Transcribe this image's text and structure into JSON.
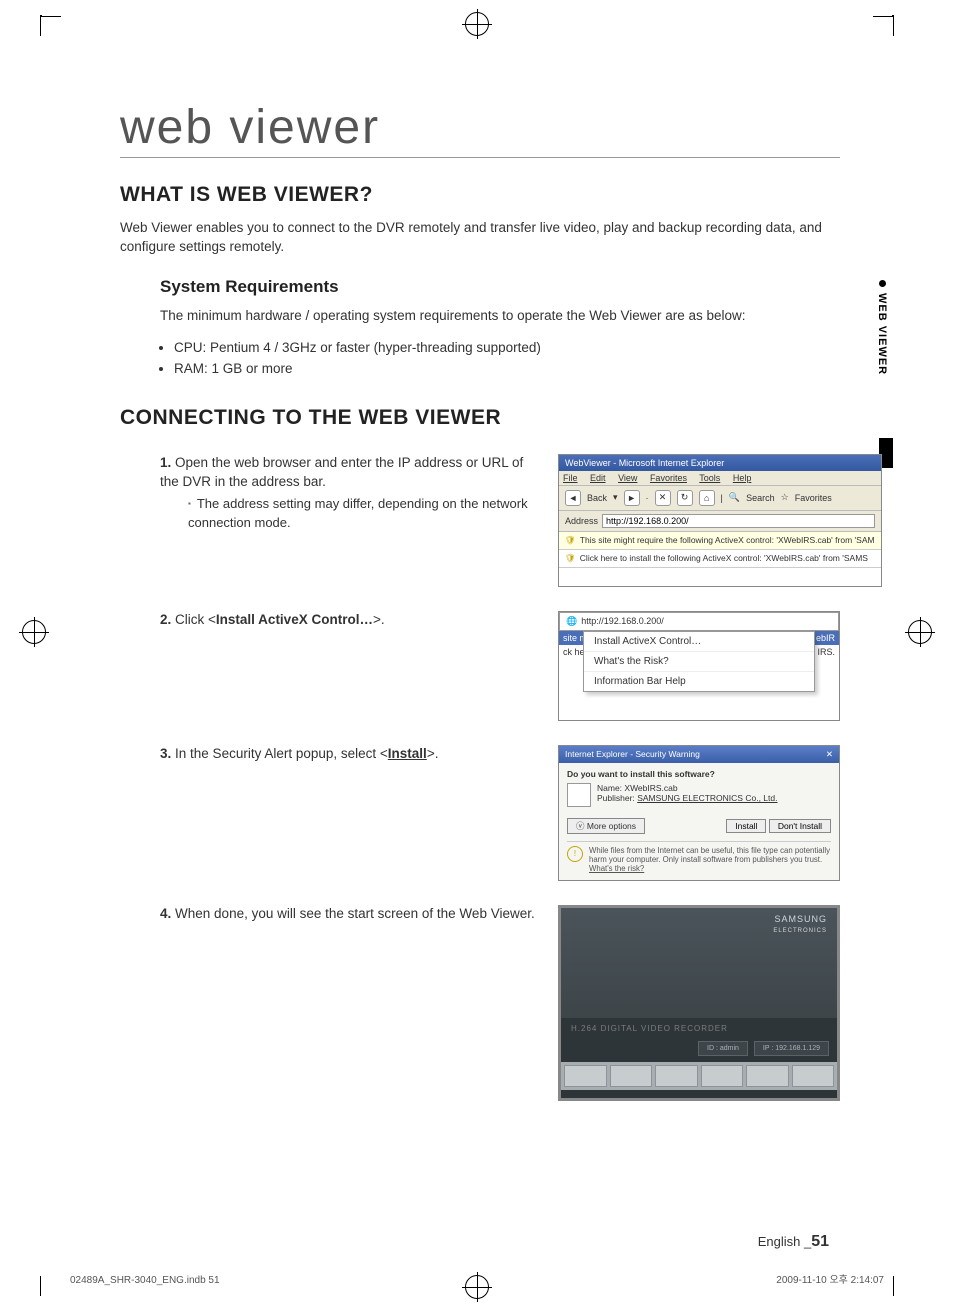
{
  "page_title": "web viewer",
  "section1": {
    "heading": "WHAT IS WEB VIEWER?",
    "intro": "Web Viewer enables you to connect to the DVR remotely and transfer live video, play and backup recording data, and configure settings remotely.",
    "sysreq_heading": "System Requirements",
    "sysreq_intro": "The minimum hardware / operating system requirements to operate the Web Viewer are as below:",
    "sysreq_items": [
      "CPU: Pentium 4 / 3GHz or faster (hyper-threading supported)",
      "RAM: 1 GB or more"
    ]
  },
  "section2": {
    "heading": "CONNECTING TO THE WEB VIEWER",
    "steps": {
      "s1": "Open the web browser and enter the IP address or URL of the DVR in the address bar.",
      "s1_sub": "The address setting may differ, depending on the network connection mode.",
      "s2_pre": "Click <",
      "s2_cmd": "Install ActiveX Control…",
      "s2_post": ">.",
      "s3_pre": "In the Security Alert popup, select <",
      "s3_cmd": "Install",
      "s3_post": ">.",
      "s4": "When done, you will see the start screen of the Web Viewer."
    }
  },
  "ie1": {
    "title": "WebViewer - Microsoft Internet Explorer",
    "menu": {
      "file": "File",
      "edit": "Edit",
      "view": "View",
      "fav": "Favorites",
      "tools": "Tools",
      "help": "Help"
    },
    "toolbar": {
      "back": "Back",
      "search": "Search",
      "favorites": "Favorites"
    },
    "addr_label": "Address",
    "addr_value": "http://192.168.0.200/",
    "info1": "This site might require the following ActiveX control: 'XWebIRS.cab' from 'SAM",
    "info2": "Click here to install the following ActiveX control: 'XWebIRS.cab' from 'SAMS"
  },
  "ie2": {
    "addr_value": "http://192.168.0.200/",
    "left_text": "site might require",
    "left_text2": "ck here to install th",
    "right_text": "ebIR",
    "right_text2": "IRS.",
    "menu": {
      "m1": "Install ActiveX Control…",
      "m2": "What's the Risk?",
      "m3": "Information Bar Help"
    }
  },
  "secwarn": {
    "title": "Internet Explorer - Security Warning",
    "question": "Do you want to install this software?",
    "name": "Name:  XWebIRS.cab",
    "publisher_label": "Publisher:",
    "publisher": "SAMSUNG ELECTRONICS Co., Ltd.",
    "more": "More options",
    "install": "Install",
    "dont": "Don't Install",
    "warn_text": "While files from the Internet can be useful, this file type can potentially harm your computer. Only install software from publishers you trust.",
    "warn_link": "What's the risk?"
  },
  "dvr": {
    "brand": "SAMSUNG",
    "sub": "ELECTRONICS",
    "mid": "H.264 DIGITAL VIDEO RECORDER",
    "id": "ID : admin",
    "ip": "IP : 192.168.1.129"
  },
  "side_tab": "WEB VIEWER",
  "footer_lang": "English _",
  "footer_page": "51",
  "print_left": "02489A_SHR-3040_ENG.indb   51",
  "print_right": "2009-11-10   오후 2:14:07"
}
